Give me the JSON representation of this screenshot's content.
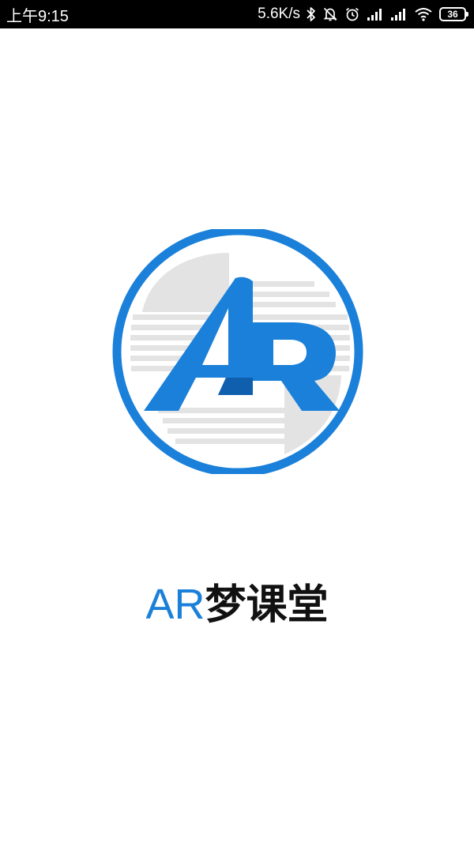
{
  "status_bar": {
    "time": "上午9:15",
    "net_speed": "5.6K/s",
    "battery_level": "36",
    "icons": [
      "bluetooth-icon",
      "mute-bell-icon",
      "alarm-icon",
      "signal-icon",
      "signal-icon",
      "wifi-icon",
      "battery-icon"
    ]
  },
  "splash": {
    "logo_letters": "AR",
    "app_name_prefix": "AR",
    "app_name_suffix": "梦课堂",
    "colors": {
      "brand_blue": "#1a80d9",
      "ring_blue": "#1a80d9",
      "page_gray": "#e3e3e3",
      "text_dark": "#111111"
    }
  }
}
